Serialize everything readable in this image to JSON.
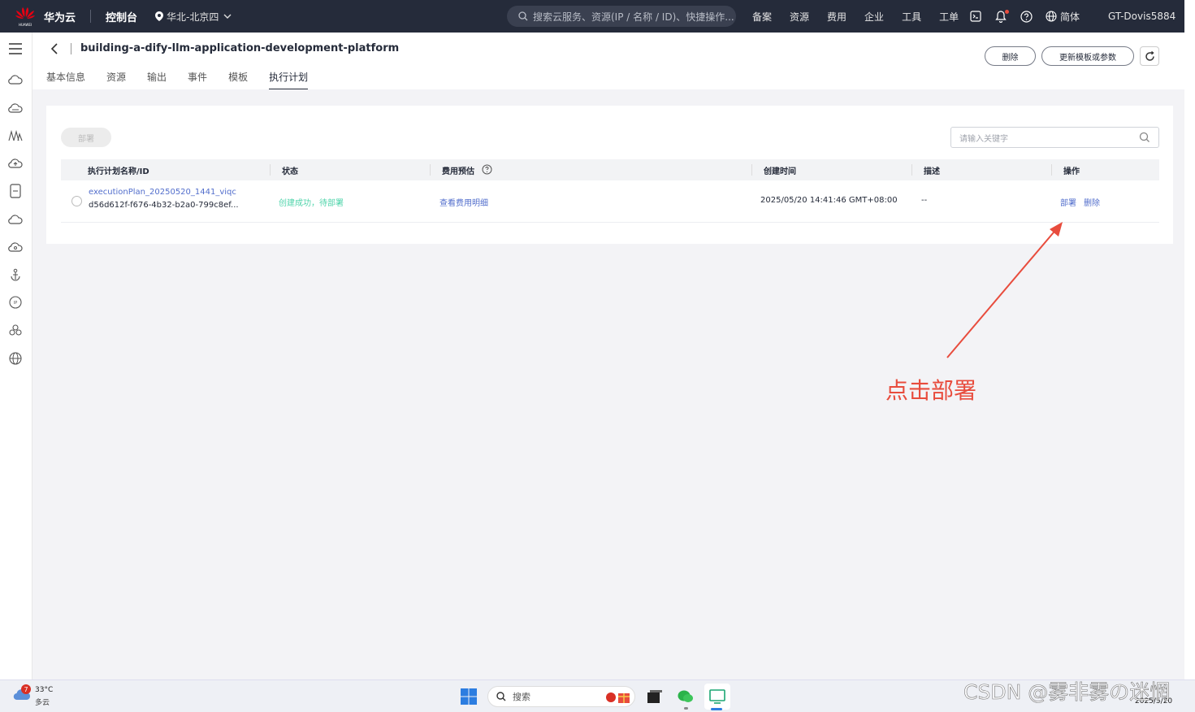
{
  "topbar": {
    "brand_small": "HUAWEI",
    "brand": "华为云",
    "console": "控制台",
    "region": "华北-北京四",
    "search_placeholder": "搜索云服务、资源(IP / 名称 / ID)、快捷操作...",
    "nav": [
      "备案",
      "资源",
      "费用",
      "企业",
      "工具",
      "工单"
    ],
    "lang": "简体",
    "user": "GT-Dovis5884"
  },
  "page": {
    "title": "building-a-dify-llm-application-development-platform",
    "tabs": [
      "基本信息",
      "资源",
      "输出",
      "事件",
      "模板",
      "执行计划"
    ],
    "active_tab": "执行计划",
    "delete_btn": "删除",
    "update_btn": "更新模板或参数"
  },
  "toolbar": {
    "deploy_btn": "部署",
    "search_placeholder": "请输入关键字"
  },
  "table": {
    "headers": [
      "执行计划名称/ID",
      "状态",
      "费用预估",
      "创建时间",
      "描述",
      "操作"
    ],
    "rows": [
      {
        "name": "executionPlan_20250520_1441_viqc",
        "id": "d56d612f-f676-4b32-b2a0-799c8ef...",
        "status": "创建成功，待部署",
        "cost": "查看费用明细",
        "created": "2025/05/20 14:41:46 GMT+08:00",
        "desc": "--",
        "action_deploy": "部署",
        "action_delete": "删除"
      }
    ]
  },
  "annotation": {
    "text": "点击部署"
  },
  "taskbar": {
    "temp": "33°C",
    "weather": "多云",
    "weather_badge": "7",
    "search": "搜索",
    "date": "2025/5/20"
  },
  "watermark": "CSDN @雾非雾の迷惘",
  "colors": {
    "topbar": "#252b3a",
    "link": "#526ecc",
    "status_green": "#50d4ab",
    "annotation_red": "#e84c3d"
  }
}
